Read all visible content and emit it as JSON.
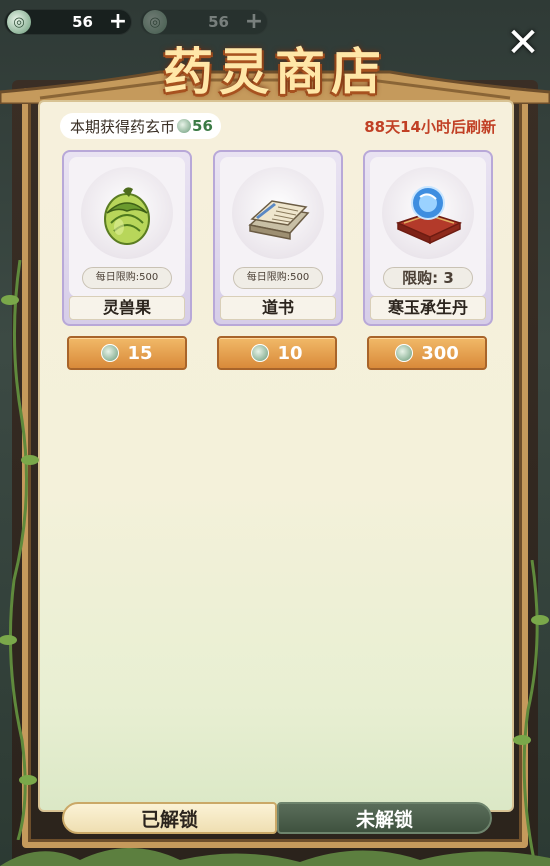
{
  "currencies": [
    {
      "icon": "yao-xuan-coin-icon",
      "amount": "56",
      "action": "+"
    },
    {
      "icon": "yao-xuan-coin-icon",
      "amount": "56",
      "action": "+"
    }
  ],
  "header": {
    "title": "药灵商店",
    "close_label": "✕"
  },
  "summary": {
    "earned_label": "本期获得药玄币",
    "earned_value": "56",
    "refresh_text": "88天14小时后刷新"
  },
  "items": [
    {
      "name": "灵兽果",
      "limit": "每日限购:500",
      "price": "15",
      "icon": "spirit-beast-fruit-icon"
    },
    {
      "name": "道书",
      "limit": "每日限购:500",
      "price": "10",
      "icon": "taoist-book-icon"
    },
    {
      "name": "寒玉承生丹",
      "limit": "限购: 3",
      "price": "300",
      "icon": "cold-jade-elixir-icon"
    }
  ],
  "tabs": [
    {
      "label": "已解锁",
      "active": true
    },
    {
      "label": "未解锁",
      "active": false
    }
  ],
  "colors": {
    "title": "#ffe7a8",
    "refresh": "#c14025",
    "price_button": "#d98a3a",
    "card_border": "#b8a8d8"
  }
}
